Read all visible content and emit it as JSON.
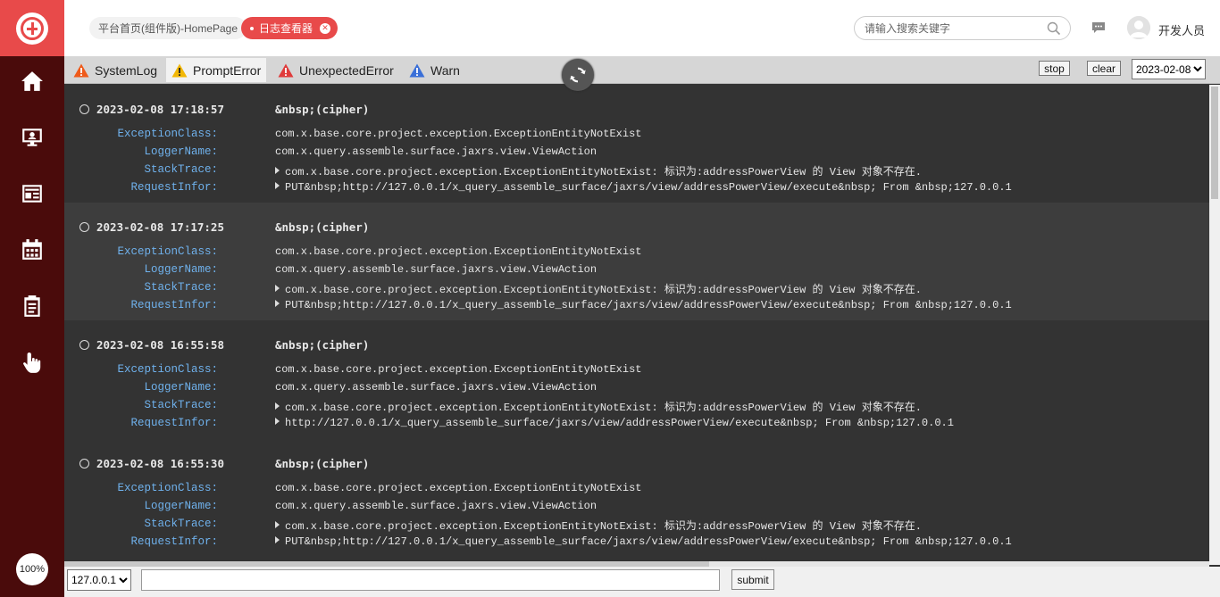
{
  "sidebar": {
    "nav_items": [
      "home-icon",
      "desktop-icon",
      "news-icon",
      "calendar-icon",
      "clipboard-icon",
      "hand-pointer-icon"
    ],
    "zoom": "100%"
  },
  "header": {
    "tabs": [
      {
        "label": "平台首页(组件版)-HomePage",
        "active": false
      },
      {
        "label": "日志查看器",
        "active": true
      }
    ],
    "search_placeholder": "请输入搜索关键字",
    "user_name": "开发人员",
    "accent_color": "#e84a4a"
  },
  "toolbar": {
    "log_tabs": [
      {
        "label": "SystemLog",
        "icon": "warning-orange-icon",
        "color": "#ef5a1a"
      },
      {
        "label": "PromptError",
        "icon": "warning-yellow-icon",
        "color": "#f2b705"
      },
      {
        "label": "UnexpectedError",
        "icon": "warning-red-icon",
        "color": "#e03b3b"
      },
      {
        "label": "Warn",
        "icon": "warning-blue-icon",
        "color": "#3a6fd8"
      }
    ],
    "stop_label": "stop",
    "clear_label": "clear",
    "date_value": "2023-02-08"
  },
  "fields": {
    "exception_class": "ExceptionClass:",
    "logger_name": "LoggerName:",
    "stack_trace": "StackTrace:",
    "request_infor": "RequestInfor:"
  },
  "entries": [
    {
      "time": "2023-02-08 17:18:57",
      "cipher": "&nbsp;(cipher)",
      "exception_class": "com.x.base.core.project.exception.ExceptionEntityNotExist",
      "logger_name": "com.x.query.assemble.surface.jaxrs.view.ViewAction",
      "stack_trace": "com.x.base.core.project.exception.ExceptionEntityNotExist: 标识为:addressPowerView 的 View 对象不存在.",
      "request_infor": "PUT&nbsp;http://127.0.0.1/x_query_assemble_surface/jaxrs/view/addressPowerView/execute&nbsp; From &nbsp;127.0.0.1"
    },
    {
      "time": "2023-02-08 17:17:25",
      "cipher": "&nbsp;(cipher)",
      "exception_class": "com.x.base.core.project.exception.ExceptionEntityNotExist",
      "logger_name": "com.x.query.assemble.surface.jaxrs.view.ViewAction",
      "stack_trace": "com.x.base.core.project.exception.ExceptionEntityNotExist: 标识为:addressPowerView 的 View 对象不存在.",
      "request_infor": "PUT&nbsp;http://127.0.0.1/x_query_assemble_surface/jaxrs/view/addressPowerView/execute&nbsp; From &nbsp;127.0.0.1"
    },
    {
      "time": "2023-02-08 16:55:58",
      "cipher": "&nbsp;(cipher)",
      "exception_class": "com.x.base.core.project.exception.ExceptionEntityNotExist",
      "logger_name": "com.x.query.assemble.surface.jaxrs.view.ViewAction",
      "stack_trace": "com.x.base.core.project.exception.ExceptionEntityNotExist: 标识为:addressPowerView 的 View 对象不存在.",
      "request_infor": "http://127.0.0.1/x_query_assemble_surface/jaxrs/view/addressPowerView/execute&nbsp; From &nbsp;127.0.0.1"
    },
    {
      "time": "2023-02-08 16:55:30",
      "cipher": "&nbsp;(cipher)",
      "exception_class": "com.x.base.core.project.exception.ExceptionEntityNotExist",
      "logger_name": "com.x.query.assemble.surface.jaxrs.view.ViewAction",
      "stack_trace": "com.x.base.core.project.exception.ExceptionEntityNotExist: 标识为:addressPowerView 的 View 对象不存在.",
      "request_infor": "PUT&nbsp;http://127.0.0.1/x_query_assemble_surface/jaxrs/view/addressPowerView/execute&nbsp; From &nbsp;127.0.0.1"
    }
  ],
  "bottom": {
    "ip_value": "127.0.0.1",
    "submit_label": "submit"
  }
}
